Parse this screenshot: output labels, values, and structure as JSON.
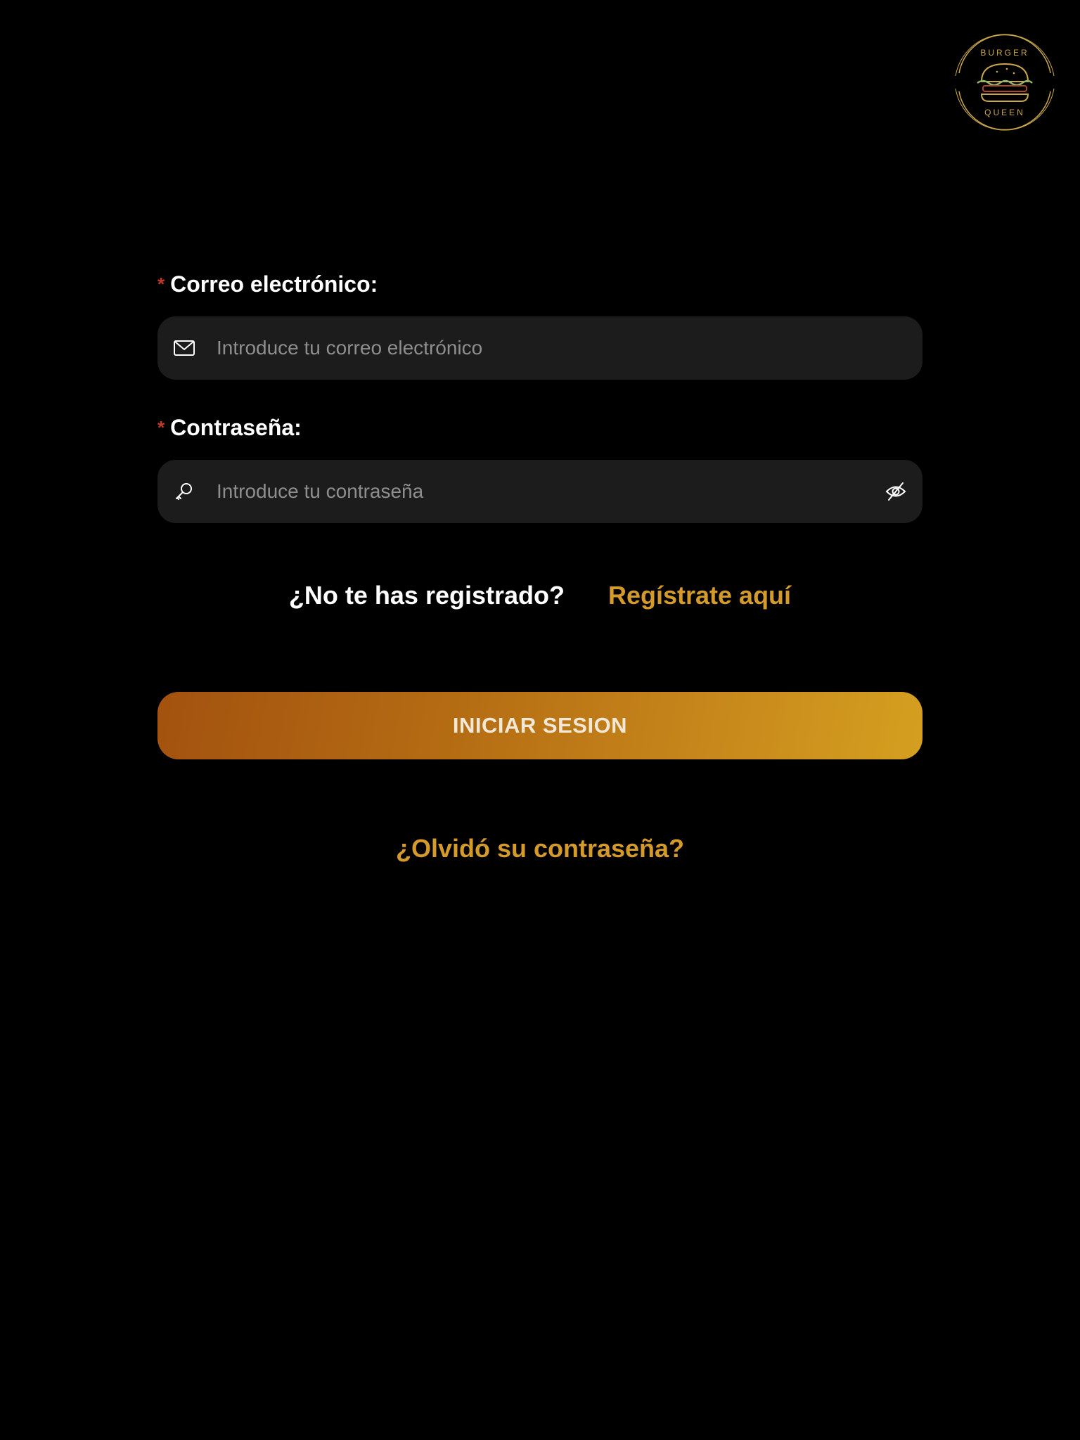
{
  "brand": {
    "logo_top_text": "BURGER",
    "logo_bottom_text": "QUEEN"
  },
  "form": {
    "email": {
      "required_mark": "*",
      "label": "Correo electrónico:",
      "placeholder": "Introduce tu correo electrónico",
      "value": ""
    },
    "password": {
      "required_mark": "*",
      "label": "Contraseña:",
      "placeholder": "Introduce tu contraseña",
      "value": ""
    }
  },
  "register": {
    "question": "¿No te has registrado?",
    "link_label": "Regístrate aquí"
  },
  "login_button_label": "INICIAR SESION",
  "forgot_password_label": "¿Olvidó su contraseña?",
  "icons": {
    "email_field": "mail-icon",
    "password_field": "key-icon",
    "password_toggle": "eye-off-icon"
  },
  "colors": {
    "background": "#000000",
    "input_background": "#1c1c1c",
    "accent": "#d49a2a",
    "required": "#c0392b",
    "button_gradient_start": "#a3520f",
    "button_gradient_end": "#d4a020"
  }
}
